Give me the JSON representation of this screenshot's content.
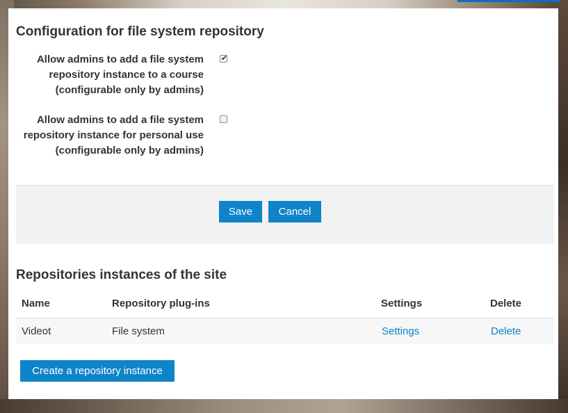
{
  "config": {
    "title": "Configuration for file system repository",
    "options": [
      {
        "lines": [
          "Allow admins to add a file system",
          "repository instance to a course",
          "(configurable only by admins)"
        ],
        "checked": true
      },
      {
        "lines": [
          "Allow admins to add a file system",
          "repository instance for personal use",
          "(configurable only by admins)"
        ],
        "checked": false
      }
    ],
    "save_label": "Save",
    "cancel_label": "Cancel"
  },
  "instances": {
    "title": "Repositories instances of the site",
    "columns": [
      "Name",
      "Repository plug-ins",
      "Settings",
      "Delete"
    ],
    "rows": [
      {
        "name": "Videot",
        "plugin": "File system",
        "settings": "Settings",
        "delete": "Delete"
      }
    ],
    "create_label": "Create a repository instance"
  },
  "colors": {
    "accent": "#0f84c9",
    "link": "#0f7fc6"
  }
}
